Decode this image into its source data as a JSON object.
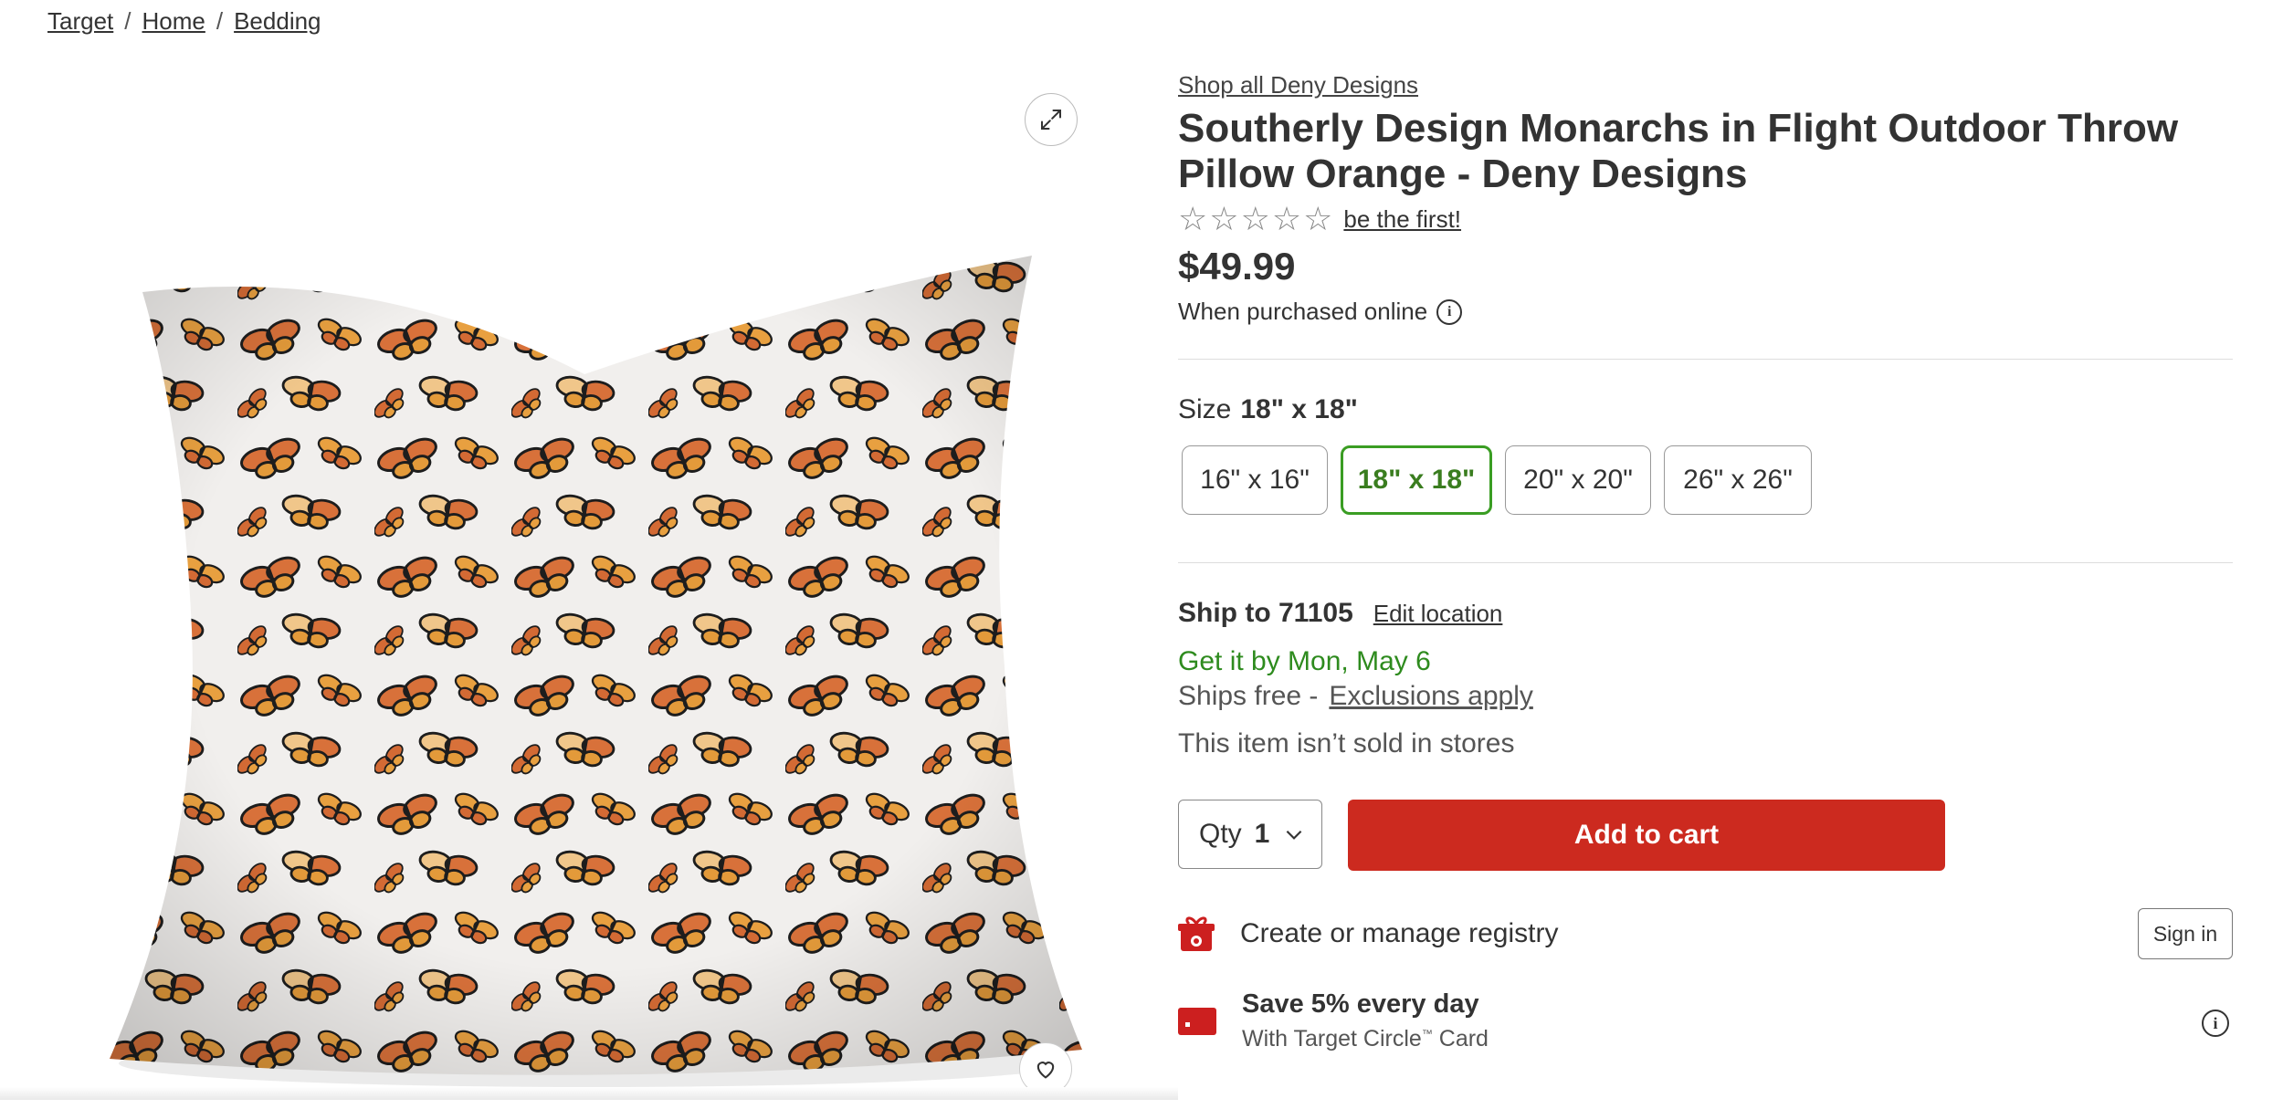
{
  "breadcrumb": {
    "items": [
      "Target",
      "Home",
      "Bedding"
    ],
    "separator": "/"
  },
  "gallery": {
    "expand_icon": "expand-arrows-icon",
    "favorite_icon": "heart-icon",
    "image_alt": "Monarch butterfly pattern throw pillow"
  },
  "product": {
    "shop_all": "Shop all Deny Designs",
    "title": "Southerly Design Monarchs in Flight Outdoor Throw Pillow Orange - Deny Designs",
    "rating_stars": 0,
    "rating_cta": "be the first!",
    "price": "$49.99",
    "price_note": "When purchased online"
  },
  "size": {
    "label": "Size",
    "selected": "18\" x 18\"",
    "options": [
      "16\" x 16\"",
      "18\" x 18\"",
      "20\" x 20\"",
      "26\" x 26\""
    ]
  },
  "shipping": {
    "ship_to": "Ship to 71105",
    "edit_location": "Edit location",
    "get_it": "Get it by Mon, May 6",
    "ships_free": "Ships free -",
    "exclusions": "Exclusions apply",
    "stores_note": "This item isn’t sold in stores"
  },
  "cart": {
    "qty_label": "Qty",
    "qty_value": "1",
    "add_to_cart": "Add to cart"
  },
  "registry": {
    "label": "Create or manage registry",
    "sign_in": "Sign in",
    "icon": "gift-icon"
  },
  "circle_card": {
    "headline": "Save 5% every day",
    "sub_prefix": "With Target Circle",
    "sub_suffix": " Card",
    "trademark": "™",
    "icon": "credit-card-icon"
  },
  "colors": {
    "accent_red": "#cc2a1f",
    "selected_green": "#3a9d23",
    "delivery_green": "#2e8b1e"
  }
}
